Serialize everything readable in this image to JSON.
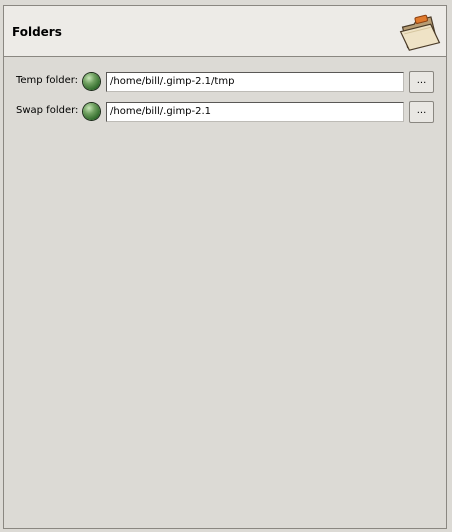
{
  "header": {
    "title": "Folders",
    "icon": "folder-icon"
  },
  "rows": [
    {
      "label": "Temp folder:",
      "status_icon": "folder-ok-icon",
      "status_color": "#4f8a45",
      "path": "/home/bill/.gimp-2.1/tmp",
      "browse_label": "..."
    },
    {
      "label": "Swap folder:",
      "status_icon": "folder-ok-icon",
      "status_color": "#4f8a45",
      "path": "/home/bill/.gimp-2.1",
      "browse_label": "..."
    }
  ],
  "colors": {
    "background": "#dcdad5",
    "header_background": "#edebe7",
    "border": "#8a8781",
    "folder_tab": "#e07a2c"
  }
}
